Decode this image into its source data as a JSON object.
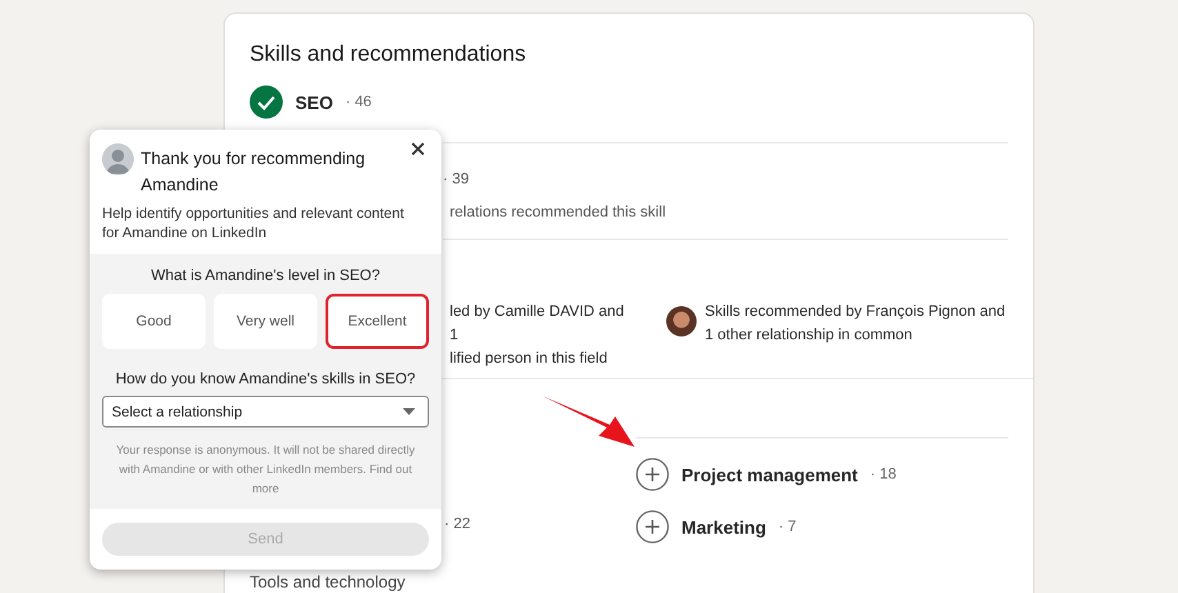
{
  "card": {
    "title": "Skills and recommendations",
    "endorsed_skill": {
      "name": "SEO",
      "count": "· 46",
      "endorsed": true
    },
    "count_fragment": "· 39",
    "note_fragment": "relations recommended this skill",
    "recommendation_fragment": [
      "led by Camille DAVID and 1",
      "lified person in this field"
    ],
    "recommendation": {
      "text": "Skills recommended by François Pignon and 1 other relationship in common"
    },
    "left_count_fragment": "· 22",
    "skills": [
      {
        "name": "Project management",
        "count": "· 18",
        "endorsed": false
      },
      {
        "name": "Marketing",
        "count": "· 7",
        "endorsed": false
      }
    ],
    "section_heading": "Tools and technology"
  },
  "popup": {
    "title": "Thank you for recommending Amandine",
    "description": "Help identify opportunities and relevant content for Amandine on LinkedIn",
    "level_question": "What is Amandine's level in SEO?",
    "levels": [
      {
        "label": "Good",
        "selected": false
      },
      {
        "label": "Very well",
        "selected": false
      },
      {
        "label": "Excellent",
        "selected": true
      }
    ],
    "relationship_question": "How do you know Amandine's skills in SEO?",
    "relationship_select": {
      "placeholder": "Select a relationship"
    },
    "notice": "Your response is anonymous. It will not be shared directly with Amandine or with other LinkedIn members. Find out more",
    "send": {
      "label": "Send",
      "disabled": true
    }
  }
}
